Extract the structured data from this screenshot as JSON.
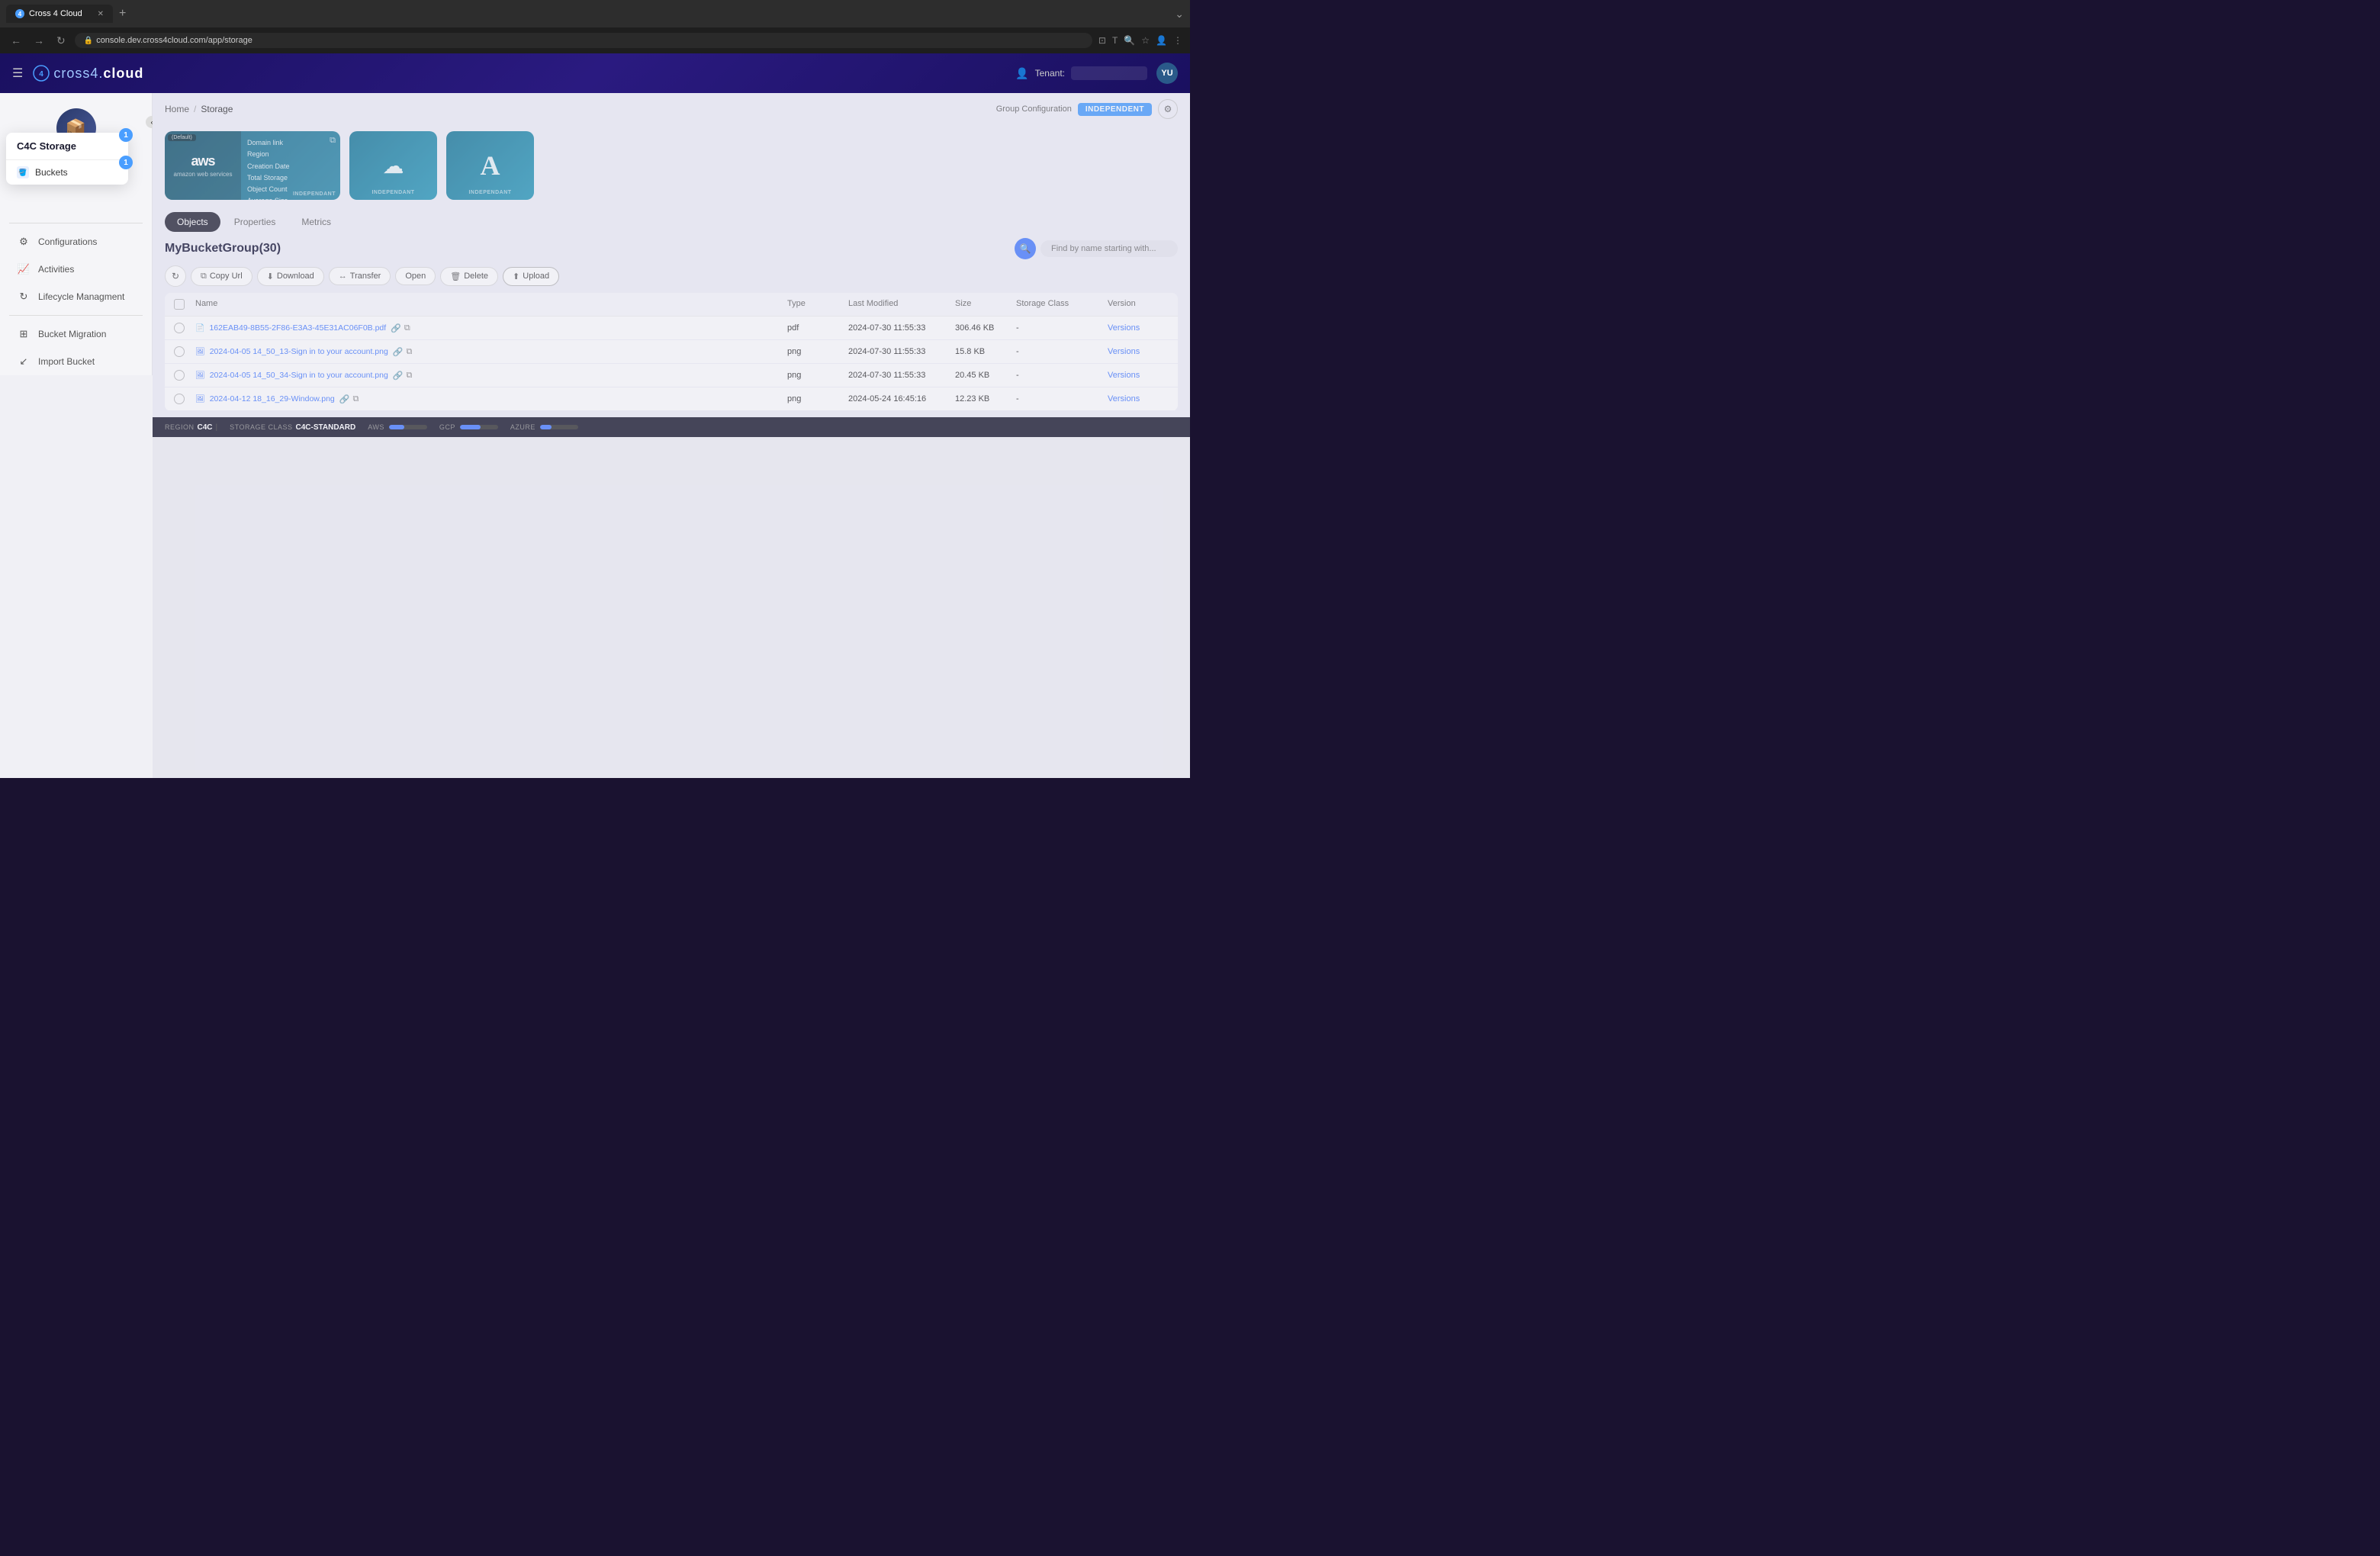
{
  "browser": {
    "tab_title": "Cross 4 Cloud",
    "tab_favicon": "4",
    "url": "console.dev.cross4cloud.com/app/storage",
    "new_tab_label": "+",
    "back_btn": "←",
    "forward_btn": "→",
    "refresh_btn": "↻"
  },
  "topnav": {
    "hamburger": "≡",
    "logo": "cross4.",
    "logo_bold": "cloud",
    "tenant_label": "Tenant:",
    "avatar_initials": "YU"
  },
  "breadcrumb": {
    "home": "Home",
    "sep": "/",
    "current": "Storage",
    "group_config": "Group Configuration",
    "independent_badge": "INDEPENDENT"
  },
  "cloud_cards": [
    {
      "id": "aws",
      "default_badge": "(Default)",
      "brand_name": "aws",
      "brand_subtitle": "amazon web services",
      "info_lines": [
        "Domain link",
        "Region",
        "Creation Date",
        "Total Storage",
        "Object Count",
        "Average Size"
      ],
      "tag": "INDEPENDANT"
    },
    {
      "id": "gcp",
      "icon": "☁",
      "tag": "INDEPENDANT"
    },
    {
      "id": "azure",
      "icon": "A",
      "tag": "INDEPENDANT"
    }
  ],
  "tabs": [
    {
      "id": "objects",
      "label": "Objects",
      "active": true
    },
    {
      "id": "properties",
      "label": "Properties",
      "active": false
    },
    {
      "id": "metrics",
      "label": "Metrics",
      "active": false
    }
  ],
  "objects": {
    "bucket_group_title": "MyBucketGroup(30)",
    "search_placeholder": "Find by name starting with...",
    "toolbar": {
      "refresh": "↻",
      "copy_url": "Copy Url",
      "download": "Download",
      "transfer": "Transfer",
      "open": "Open",
      "delete": "Delete",
      "upload": "Upload"
    },
    "table": {
      "headers": [
        "",
        "Name",
        "Type",
        "Last Modified",
        "Size",
        "Storage Class",
        "Version"
      ],
      "rows": [
        {
          "name": "162EAB49-8B55-2F86-E3A3-45E31AC06F0B.pdf",
          "type": "pdf",
          "last_modified": "2024-07-30 11:55:33",
          "size": "306.46 KB",
          "storage_class": "-",
          "version": "Versions"
        },
        {
          "name": "2024-04-05 14_50_13-Sign in to your account.png",
          "type": "png",
          "last_modified": "2024-07-30 11:55:33",
          "size": "15.8 KB",
          "storage_class": "-",
          "version": "Versions"
        },
        {
          "name": "2024-04-05 14_50_34-Sign in to your account.png",
          "type": "png",
          "last_modified": "2024-07-30 11:55:33",
          "size": "20.45 KB",
          "storage_class": "-",
          "version": "Versions"
        },
        {
          "name": "2024-04-12 18_16_29-Window.png",
          "type": "png",
          "last_modified": "2024-05-24 16:45:16",
          "size": "12.23 KB",
          "storage_class": "-",
          "version": "Versions"
        }
      ]
    }
  },
  "sidebar": {
    "dropdown_title": "C4C Storage",
    "dropdown_badge": "1",
    "buckets_label": "Buckets",
    "nav_items": [
      {
        "id": "configurations",
        "label": "Configurations",
        "icon": "⚙"
      },
      {
        "id": "activities",
        "label": "Activities",
        "icon": "📈"
      },
      {
        "id": "lifecycle",
        "label": "Lifecycle Managment",
        "icon": "↻"
      },
      {
        "id": "bucket-migration",
        "label": "Bucket Migration",
        "icon": "⊞"
      },
      {
        "id": "import-bucket",
        "label": "Import Bucket",
        "icon": "↙"
      }
    ]
  },
  "statusbar": {
    "region_label": "REGION",
    "region_value": "C4C",
    "pipe": "|",
    "storage_class_label": "STORAGE CLASS",
    "storage_class_value": "C4C-STANDARD",
    "aws_label": "AWS",
    "gcp_label": "GCP",
    "azure_label": "AZURE"
  }
}
